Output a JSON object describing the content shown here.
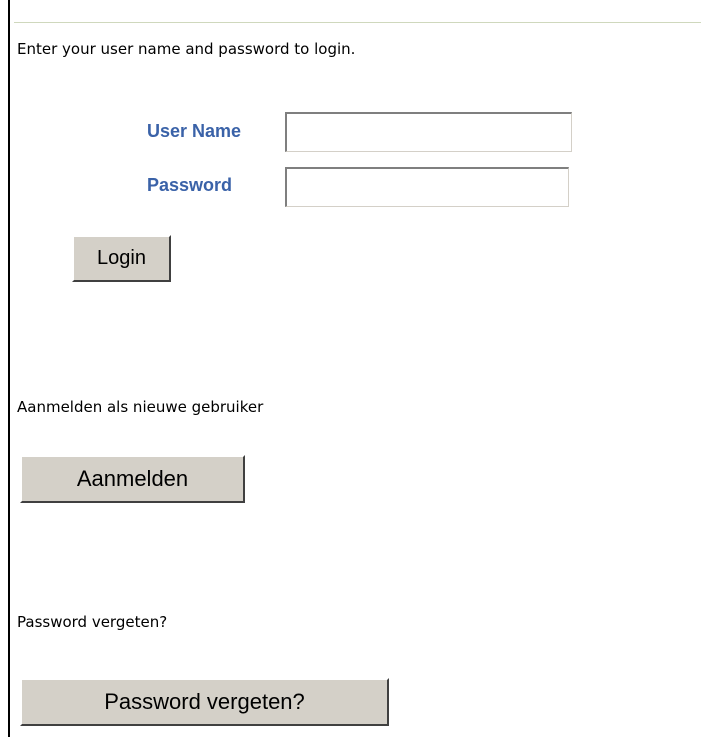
{
  "login": {
    "intro_text": "Enter your user name and password to login.",
    "username_label": "User Name",
    "username_value": "",
    "password_label": "Password",
    "password_value": "",
    "login_button": "Login"
  },
  "register": {
    "text": "Aanmelden als nieuwe gebruiker",
    "button": "Aanmelden"
  },
  "forgot": {
    "text": "Password vergeten?",
    "button": "Password vergeten?"
  },
  "colors": {
    "label_blue": "#3a62a8",
    "button_face": "#d4d0c8",
    "rule": "#cfd8bd"
  }
}
